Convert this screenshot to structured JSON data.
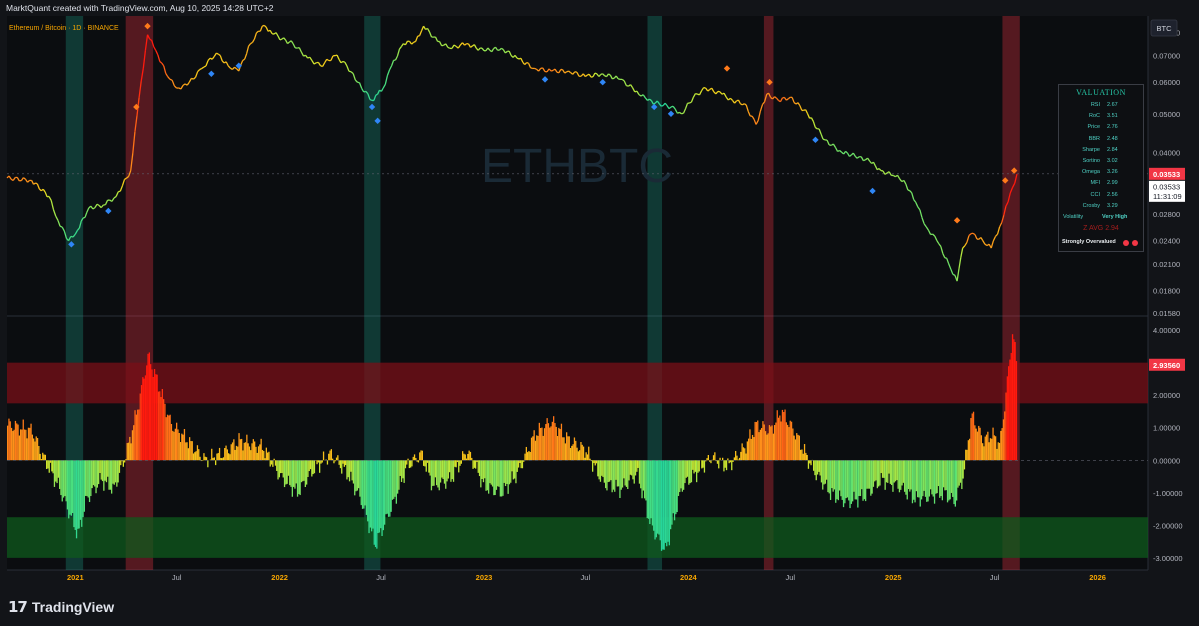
{
  "attribution": "MarktQuant created with TradingView.com, Aug 10, 2025 14:28 UTC+2",
  "legend": "Ethereum / Bitcoin · 1D · BINANCE",
  "currency_button": "BTC",
  "watermark": "ETHBTC",
  "brand": "TradingView",
  "price_axis": {
    "ticks": [
      "0.08000",
      "0.07000",
      "0.06000",
      "0.05000",
      "0.04000",
      "0.03200",
      "0.02800",
      "0.02400",
      "0.02100",
      "0.01800",
      "0.01580"
    ],
    "last_price": "0.03533",
    "crosshair_price": "0.03533",
    "crosshair_time": "11:31:09"
  },
  "osc_axis": {
    "ticks": [
      "4.00000",
      "3.00000",
      "2.00000",
      "1.00000",
      "0.00000",
      "-1.00000",
      "-2.00000",
      "-3.00000"
    ],
    "last_value": "2.93560"
  },
  "time_axis": [
    {
      "label": "2021",
      "bold": true
    },
    {
      "label": "Jul",
      "bold": false
    },
    {
      "label": "2022",
      "bold": true
    },
    {
      "label": "Jul",
      "bold": false
    },
    {
      "label": "2023",
      "bold": true
    },
    {
      "label": "Jul",
      "bold": false
    },
    {
      "label": "2024",
      "bold": true
    },
    {
      "label": "Jul",
      "bold": false
    },
    {
      "label": "2025",
      "bold": true
    },
    {
      "label": "Jul",
      "bold": false
    },
    {
      "label": "2026",
      "bold": true
    }
  ],
  "valuation": {
    "title": "VALUATION",
    "rows": [
      {
        "label": "RSI",
        "value": "2.67"
      },
      {
        "label": "RoC",
        "value": "3.51"
      },
      {
        "label": "Price",
        "value": "2.76"
      },
      {
        "label": "BBR",
        "value": "2.48"
      },
      {
        "label": "Sharpe",
        "value": "2.84"
      },
      {
        "label": "Sortino",
        "value": "3.02"
      },
      {
        "label": "Omega",
        "value": "3.26"
      },
      {
        "label": "MFI",
        "value": "2.99"
      },
      {
        "label": "CCI",
        "value": "2.56"
      },
      {
        "label": "Crosby",
        "value": "3.29"
      }
    ],
    "volatility_label": "Volatility",
    "volatility_value": "Very High",
    "z_avg": "Z AVG 2.94",
    "state": "Strongly Overvalued"
  },
  "colors": {
    "background": "#121418",
    "pane_bg": "#0b0d10",
    "up_band": "#f23645",
    "down_band": "#22ab94",
    "last_price_tag": "#f23645",
    "cold_start": "#1fd3a0",
    "hot_end": "#ff1a0e"
  },
  "chart_data": [
    {
      "type": "line",
      "title": "Ethereum / Bitcoin · 1D · BINANCE",
      "y_scale": "log",
      "ylim": [
        0.0158,
        0.085
      ],
      "xlim": [
        "2020-09-01",
        "2026-04-01"
      ],
      "series": [
        {
          "x": [
            "2020-09-01",
            "2020-10-15",
            "2020-11-15",
            "2020-12-01",
            "2020-12-20",
            "2021-01-05",
            "2021-01-25",
            "2021-02-20",
            "2021-03-15",
            "2021-04-10",
            "2021-04-25",
            "2021-05-10",
            "2021-05-25",
            "2021-06-15",
            "2021-07-01",
            "2021-07-20",
            "2021-08-15",
            "2021-09-10",
            "2021-10-01",
            "2021-10-20",
            "2021-11-10",
            "2021-12-01",
            "2021-12-15",
            "2022-01-05",
            "2022-01-25",
            "2022-02-20",
            "2022-03-15",
            "2022-04-10",
            "2022-05-01",
            "2022-05-20",
            "2022-06-15",
            "2022-06-25",
            "2022-07-05",
            "2022-07-20",
            "2022-08-10",
            "2022-09-01",
            "2022-09-15",
            "2022-10-10",
            "2022-11-01",
            "2022-12-01",
            "2023-01-01",
            "2023-02-01",
            "2023-03-01",
            "2023-04-01",
            "2023-05-01",
            "2023-06-01",
            "2023-07-01",
            "2023-08-01",
            "2023-09-01",
            "2023-10-01",
            "2023-10-20",
            "2023-11-10",
            "2023-12-01",
            "2023-12-20",
            "2024-01-10",
            "2024-02-01",
            "2024-03-01",
            "2024-03-20",
            "2024-04-10",
            "2024-05-01",
            "2024-05-20",
            "2024-06-10",
            "2024-07-01",
            "2024-08-01",
            "2024-09-01",
            "2024-10-01",
            "2024-11-01",
            "2024-11-20",
            "2024-12-10",
            "2025-01-01",
            "2025-01-20",
            "2025-02-10",
            "2025-03-01",
            "2025-03-20",
            "2025-04-10",
            "2025-04-25",
            "2025-05-05",
            "2025-05-20",
            "2025-06-10",
            "2025-06-25",
            "2025-07-10",
            "2025-07-25",
            "2025-08-10"
          ],
          "y": [
            0.0345,
            0.034,
            0.031,
            0.027,
            0.024,
            0.0255,
            0.029,
            0.0295,
            0.031,
            0.036,
            0.055,
            0.079,
            0.072,
            0.062,
            0.058,
            0.059,
            0.065,
            0.071,
            0.066,
            0.064,
            0.075,
            0.083,
            0.081,
            0.077,
            0.075,
            0.069,
            0.066,
            0.07,
            0.066,
            0.06,
            0.054,
            0.056,
            0.058,
            0.066,
            0.075,
            0.076,
            0.083,
            0.076,
            0.073,
            0.075,
            0.072,
            0.073,
            0.069,
            0.065,
            0.064,
            0.064,
            0.062,
            0.063,
            0.061,
            0.057,
            0.054,
            0.053,
            0.052,
            0.05,
            0.055,
            0.058,
            0.056,
            0.054,
            0.053,
            0.047,
            0.056,
            0.054,
            0.055,
            0.05,
            0.043,
            0.04,
            0.039,
            0.038,
            0.036,
            0.035,
            0.034,
            0.03,
            0.026,
            0.024,
            0.021,
            0.019,
            0.023,
            0.025,
            0.024,
            0.023,
            0.026,
            0.03,
            0.0353
          ]
        }
      ],
      "overbought_periods": [
        [
          "2021-04-01",
          "2021-05-20"
        ],
        [
          "2024-05-15",
          "2024-06-01"
        ],
        [
          "2025-07-15",
          "2025-08-15"
        ]
      ],
      "oversold_periods": [
        [
          "2020-12-15",
          "2021-01-15"
        ],
        [
          "2022-06-01",
          "2022-06-30"
        ],
        [
          "2023-10-20",
          "2023-11-15"
        ]
      ],
      "markers": {
        "overvalued_orange": [
          [
            "2021-04-20",
            0.052
          ],
          [
            "2021-05-10",
            0.083
          ],
          [
            "2024-03-10",
            0.065
          ],
          [
            "2024-05-25",
            0.06
          ],
          [
            "2025-04-25",
            0.027
          ],
          [
            "2025-07-20",
            0.034
          ],
          [
            "2025-08-05",
            0.036
          ]
        ],
        "undervalued_blue": [
          [
            "2020-12-25",
            0.0235
          ],
          [
            "2021-03-01",
            0.0285
          ],
          [
            "2021-10-20",
            0.066
          ],
          [
            "2021-09-01",
            0.063
          ],
          [
            "2022-06-15",
            0.052
          ],
          [
            "2022-06-25",
            0.048
          ],
          [
            "2023-04-20",
            0.061
          ],
          [
            "2023-08-01",
            0.06
          ],
          [
            "2023-11-01",
            0.052
          ],
          [
            "2024-08-15",
            0.043
          ],
          [
            "2024-11-25",
            0.032
          ],
          [
            "2023-12-01",
            0.05
          ]
        ]
      }
    },
    {
      "type": "area",
      "title": "",
      "ylim": [
        -3.25,
        4.25
      ],
      "overvalued_band": [
        1.75,
        3.0
      ],
      "undervalued_band": [
        -3.0,
        -1.75
      ],
      "series": [
        {
          "x": [
            "2020-09-01",
            "2020-10-15",
            "2020-11-01",
            "2020-12-01",
            "2020-12-20",
            "2021-01-05",
            "2021-01-20",
            "2021-02-15",
            "2021-03-10",
            "2021-04-01",
            "2021-04-20",
            "2021-05-10",
            "2021-05-25",
            "2021-06-20",
            "2021-07-20",
            "2021-08-20",
            "2021-09-20",
            "2021-10-20",
            "2021-11-10",
            "2021-12-01",
            "2022-01-01",
            "2022-02-01",
            "2022-03-01",
            "2022-04-01",
            "2022-05-01",
            "2022-05-25",
            "2022-06-20",
            "2022-07-10",
            "2022-07-25",
            "2022-08-15",
            "2022-09-10",
            "2022-10-01",
            "2022-11-01",
            "2022-12-01",
            "2023-01-01",
            "2023-02-01",
            "2023-03-01",
            "2023-04-01",
            "2023-05-01",
            "2023-06-01",
            "2023-07-01",
            "2023-08-01",
            "2023-09-01",
            "2023-10-01",
            "2023-10-25",
            "2023-11-20",
            "2023-12-20",
            "2024-01-15",
            "2024-02-10",
            "2024-03-10",
            "2024-04-10",
            "2024-05-01",
            "2024-05-25",
            "2024-06-15",
            "2024-07-10",
            "2024-08-10",
            "2024-09-10",
            "2024-10-10",
            "2024-11-10",
            "2024-12-10",
            "2025-01-10",
            "2025-02-10",
            "2025-03-10",
            "2025-04-01",
            "2025-04-20",
            "2025-05-05",
            "2025-05-20",
            "2025-06-10",
            "2025-06-25",
            "2025-07-10",
            "2025-07-20",
            "2025-08-01",
            "2025-08-10"
          ],
          "y": [
            1.1,
            0.9,
            0.2,
            -0.8,
            -1.6,
            -2.3,
            -1.2,
            -0.6,
            -0.9,
            0.2,
            1.5,
            3.2,
            2.5,
            1.1,
            0.6,
            0.0,
            0.2,
            0.6,
            0.5,
            0.4,
            -0.5,
            -1.0,
            -0.3,
            0.2,
            -0.4,
            -1.2,
            -2.6,
            -1.8,
            -1.2,
            -0.2,
            0.2,
            -0.8,
            -0.6,
            0.3,
            -0.8,
            -1.0,
            -0.4,
            0.8,
            1.2,
            0.6,
            0.3,
            -0.7,
            -0.9,
            -0.4,
            -2.0,
            -2.8,
            -0.8,
            -0.4,
            0.1,
            -0.2,
            0.4,
            1.1,
            0.9,
            1.5,
            0.8,
            -0.3,
            -1.0,
            -1.3,
            -1.1,
            -0.6,
            -0.8,
            -1.2,
            -1.1,
            -1.0,
            -1.3,
            -0.5,
            1.4,
            0.6,
            0.8,
            0.5,
            2.0,
            3.9,
            2.9
          ]
        }
      ]
    }
  ]
}
